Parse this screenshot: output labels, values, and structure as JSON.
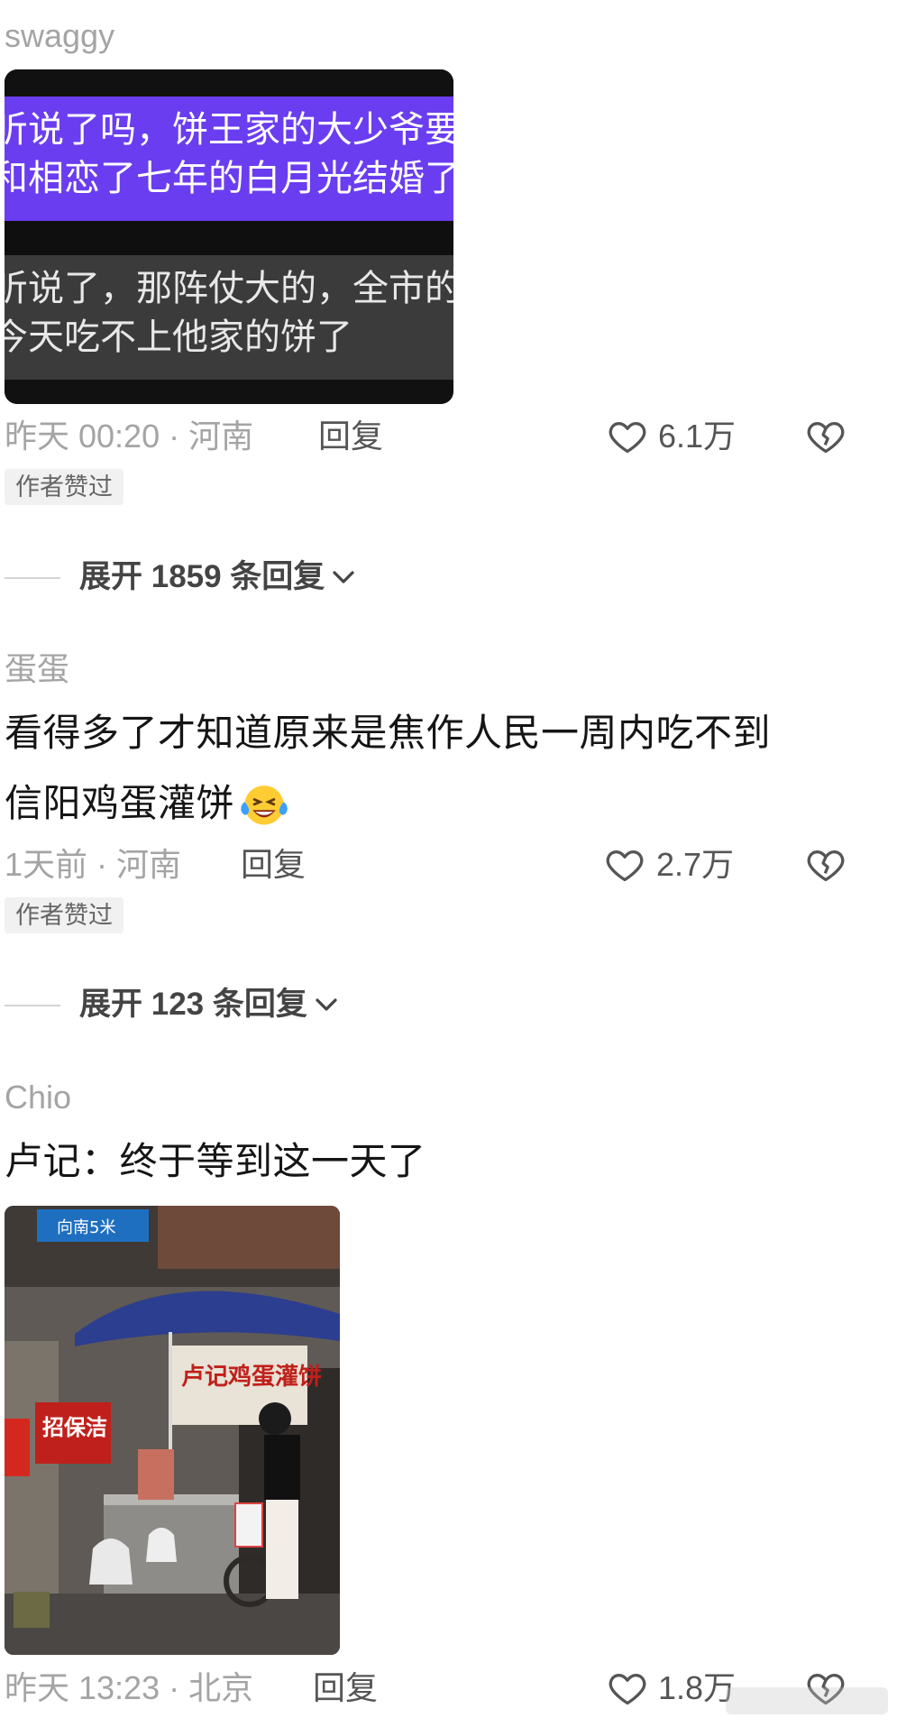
{
  "comments": [
    {
      "username": "swaggy",
      "image_text": [
        "听说了吗，饼王家的大少爷要",
        "和相恋了七年的白月光结婚了",
        "听说了，那阵仗大的，全市的人",
        "今天吃不上他家的饼了"
      ],
      "meta": "昨天 00:20 · 河南",
      "reply_label": "回复",
      "likes": "6.1万",
      "badge": "作者赞过",
      "expand_label": "展开 1859 条回复"
    },
    {
      "username": "蛋蛋",
      "text_line1": "看得多了才知道原来是焦作人民一周内吃不到",
      "text_line2": "信阳鸡蛋灌饼",
      "meta": "1天前 · 河南",
      "reply_label": "回复",
      "likes": "2.7万",
      "badge": "作者赞过",
      "expand_label": "展开 123 条回复"
    },
    {
      "username": "Chio",
      "text": "卢记：终于等到这一天了",
      "photo_signs": {
        "direction": "向南5米",
        "stall_name": "卢记鸡蛋灌饼",
        "poster": "招保洁"
      },
      "meta": "昨天 13:23 · 北京",
      "reply_label": "回复",
      "likes": "1.8万"
    }
  ],
  "icons": {
    "like": "heart-outline-icon",
    "dislike": "broken-heart-icon",
    "expand": "chevron-down-icon",
    "emoji": "laughing-tears-emoji"
  },
  "colors": {
    "purple_banner": "#6a3df0",
    "meta_gray": "#a4a4a4"
  }
}
